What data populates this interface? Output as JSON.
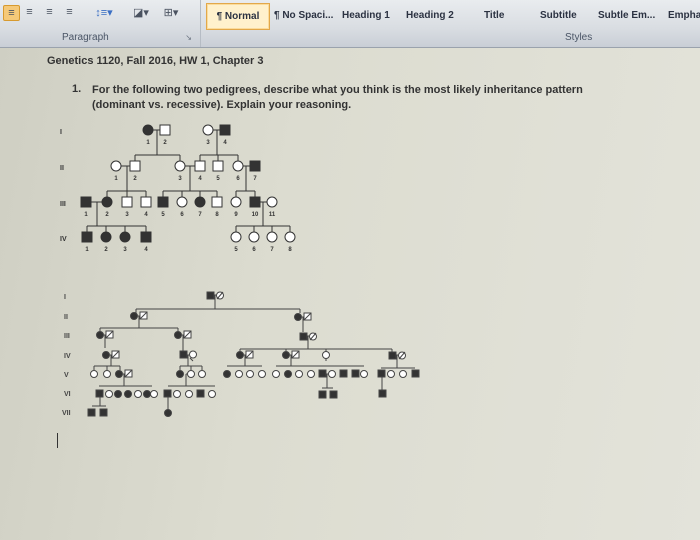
{
  "ribbon": {
    "paragraph_group": {
      "label": "Paragraph",
      "buttons": [
        {
          "name": "align-left-icon",
          "glyph": "≡",
          "active": true
        },
        {
          "name": "align-center-icon",
          "glyph": "≡",
          "active": false
        },
        {
          "name": "align-right-icon",
          "glyph": "≡",
          "active": false
        },
        {
          "name": "justify-icon",
          "glyph": "≡",
          "active": false
        },
        {
          "name": "line-spacing-icon",
          "glyph": "↕≡▾",
          "active": false
        },
        {
          "name": "shading-icon",
          "glyph": "◪▾",
          "active": false
        },
        {
          "name": "borders-icon",
          "glyph": "⊞▾",
          "active": false
        }
      ],
      "launcher": "↘"
    },
    "styles_group": {
      "label": "Styles",
      "items": [
        {
          "label": "¶ Normal",
          "active": true
        },
        {
          "label": "¶ No Spaci...",
          "active": false
        },
        {
          "label": "Heading 1",
          "active": false
        },
        {
          "label": "Heading 2",
          "active": false
        },
        {
          "label": "Title",
          "active": false
        },
        {
          "label": "Subtitle",
          "active": false
        },
        {
          "label": "Subtle Em...",
          "active": false
        },
        {
          "label": "Empha",
          "active": false
        }
      ]
    }
  },
  "document": {
    "title": "Genetics 1120, Fall 2016, HW 1, Chapter 3",
    "question_number": "1.",
    "question_text": "For the following two pedigrees, describe what you think is the most likely inheritance pattern (dominant vs. recessive). Explain your reasoning.",
    "pedigree1": {
      "generations": [
        "I",
        "II",
        "III",
        "IV"
      ],
      "individuals": {
        "I": [
          {
            "id": "1",
            "sex": "F",
            "affected": true
          },
          {
            "id": "2",
            "sex": "M",
            "affected": false
          },
          {
            "id": "3",
            "sex": "F",
            "affected": false
          },
          {
            "id": "4",
            "sex": "M",
            "affected": true
          }
        ],
        "II": [
          {
            "id": "1",
            "sex": "F",
            "affected": false
          },
          {
            "id": "2",
            "sex": "M",
            "affected": false
          },
          {
            "id": "3",
            "sex": "F",
            "affected": false
          },
          {
            "id": "4",
            "sex": "M",
            "affected": false
          },
          {
            "id": "5",
            "sex": "M",
            "affected": false
          },
          {
            "id": "6",
            "sex": "F",
            "affected": false
          },
          {
            "id": "7",
            "sex": "M",
            "affected": true
          }
        ],
        "III": [
          {
            "id": "1",
            "sex": "M",
            "affected": true
          },
          {
            "id": "2",
            "sex": "F",
            "affected": true
          },
          {
            "id": "3",
            "sex": "M",
            "affected": false
          },
          {
            "id": "4",
            "sex": "M",
            "affected": false
          },
          {
            "id": "5",
            "sex": "M",
            "affected": true
          },
          {
            "id": "6",
            "sex": "F",
            "affected": false
          },
          {
            "id": "7",
            "sex": "F",
            "affected": true
          },
          {
            "id": "8",
            "sex": "M",
            "affected": false
          },
          {
            "id": "9",
            "sex": "F",
            "affected": false
          },
          {
            "id": "10",
            "sex": "M",
            "affected": true
          },
          {
            "id": "11",
            "sex": "F",
            "affected": false
          }
        ],
        "IV": [
          {
            "id": "1",
            "sex": "M",
            "affected": true
          },
          {
            "id": "2",
            "sex": "F",
            "affected": true
          },
          {
            "id": "3",
            "sex": "F",
            "affected": true
          },
          {
            "id": "4",
            "sex": "M",
            "affected": true
          },
          {
            "id": "5",
            "sex": "F",
            "affected": false
          },
          {
            "id": "6",
            "sex": "F",
            "affected": false
          },
          {
            "id": "7",
            "sex": "F",
            "affected": false
          },
          {
            "id": "8",
            "sex": "F",
            "affected": false
          }
        ]
      }
    },
    "pedigree2": {
      "generations": [
        "I",
        "II",
        "III",
        "IV",
        "V",
        "VI",
        "VII"
      ]
    }
  }
}
